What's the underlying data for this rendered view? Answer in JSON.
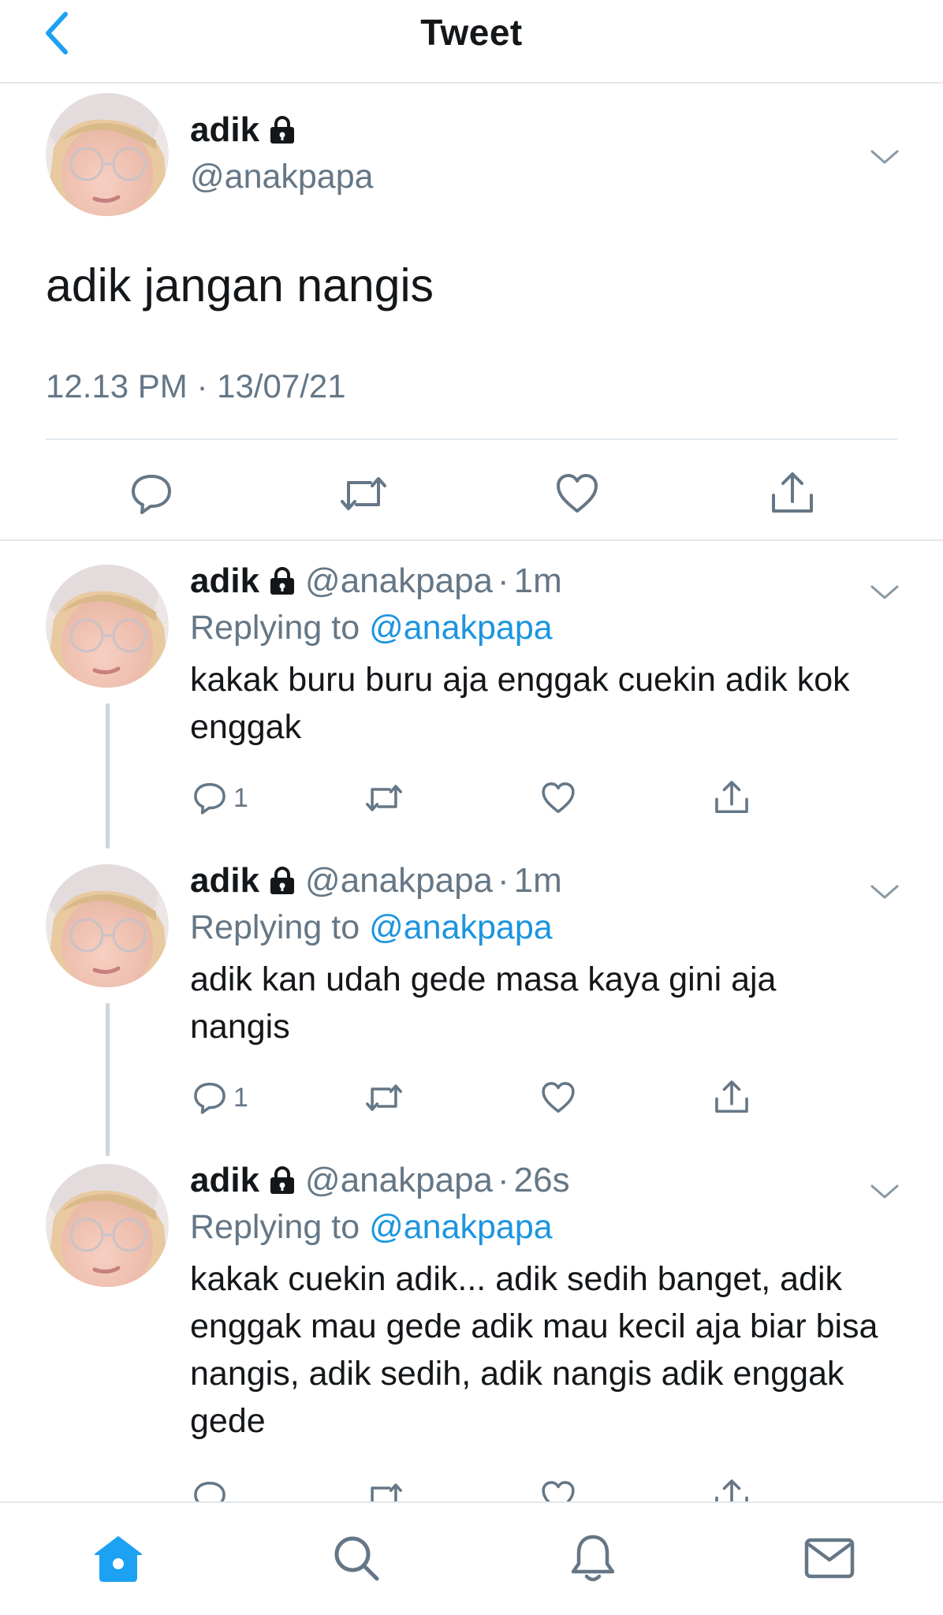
{
  "header": {
    "title": "Tweet",
    "back_icon": "chevron-left-icon"
  },
  "colors": {
    "accent": "#1da1f2",
    "mention": "#1b95e0",
    "secondary_text": "#657786",
    "divider": "#e1e8ed",
    "thread_line": "#ccd6dd"
  },
  "main_tweet": {
    "name": "adik",
    "handle": "@anakpapa",
    "text": "adik jangan nangis",
    "timestamp": "12.13 PM · 13/07/21",
    "protected_icon": "lock-icon",
    "menu_icon": "chevron-down-icon"
  },
  "replies": [
    {
      "name": "adik",
      "handle": "@anakpapa",
      "dot": "·",
      "time": "1m",
      "replying_prefix": "Replying to",
      "replying_to": "@anakpapa",
      "text": "kakak buru buru aja enggak cuekin adik kok enggak",
      "reply_count": "1"
    },
    {
      "name": "adik",
      "handle": "@anakpapa",
      "dot": "·",
      "time": "1m",
      "replying_prefix": "Replying to",
      "replying_to": "@anakpapa",
      "text": "adik kan udah gede masa kaya gini aja nangis",
      "reply_count": "1"
    },
    {
      "name": "adik",
      "handle": "@anakpapa",
      "dot": "·",
      "time": "26s",
      "replying_prefix": "Replying to",
      "replying_to": "@anakpapa",
      "text": "kakak cuekin adik... adik sedih banget, adik enggak mau gede adik mau kecil aja biar bisa nangis, adik sedih, adik nangis adik enggak gede",
      "reply_count": ""
    }
  ],
  "tabbar": {
    "items": [
      "home-icon",
      "search-icon",
      "notifications-bell-icon",
      "messages-mail-icon"
    ],
    "active": "home-icon"
  }
}
